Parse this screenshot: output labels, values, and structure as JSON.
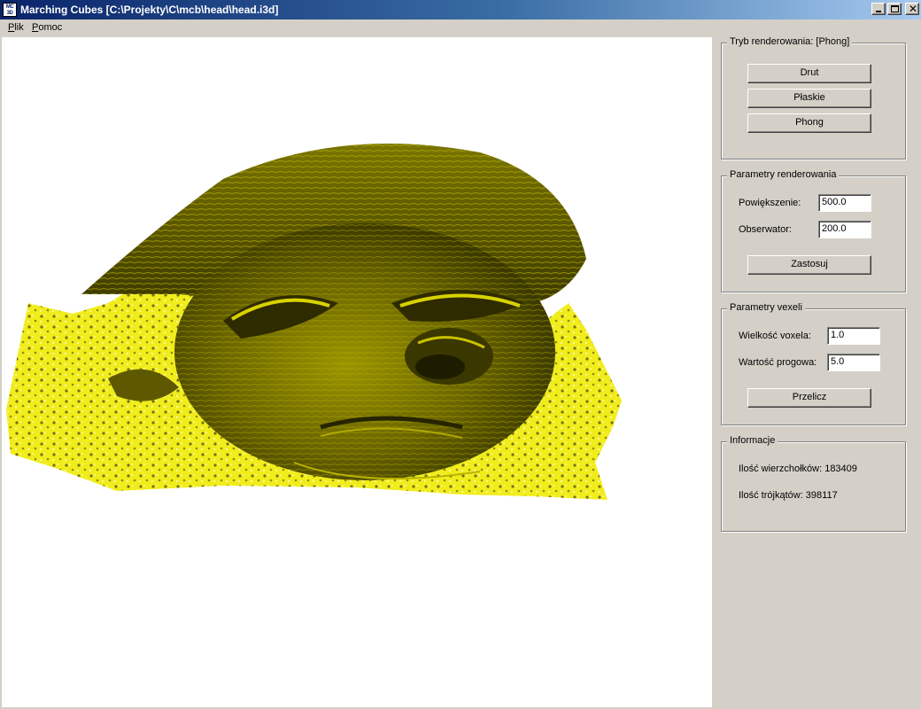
{
  "window": {
    "icon_text": "MC3D",
    "title": "Marching Cubes [C:\\Projekty\\C\\mcb\\head\\head.i3d]"
  },
  "menu": [
    "Plik",
    "Pomoc"
  ],
  "render_mode": {
    "title": "Tryb renderowania: [Phong]",
    "buttons": [
      "Drut",
      "Płaskie",
      "Phong"
    ]
  },
  "render_params": {
    "title": "Parametry renderowania",
    "zoom_label": "Powiększenie:",
    "zoom_value": "500.0",
    "observer_label": "Obserwator:",
    "observer_value": "200.0",
    "apply_button": "Zastosuj"
  },
  "voxel_params": {
    "title": "Parametry vexeli",
    "voxel_size_label": "Wielkość voxela:",
    "voxel_size_value": "1.0",
    "threshold_label": "Wartość progowa:",
    "threshold_value": "5.0",
    "recalc_button": "Przelicz"
  },
  "info": {
    "title": "Informacje",
    "vertices": "Ilość wierzchołków: 183409",
    "triangles": "Ilość trójkątów: 398117"
  },
  "colors": {
    "mesh_dark": "#4a4600",
    "mesh_mid": "#8a8400",
    "mesh_light": "#e6e200",
    "noise": "#f2ee10"
  }
}
